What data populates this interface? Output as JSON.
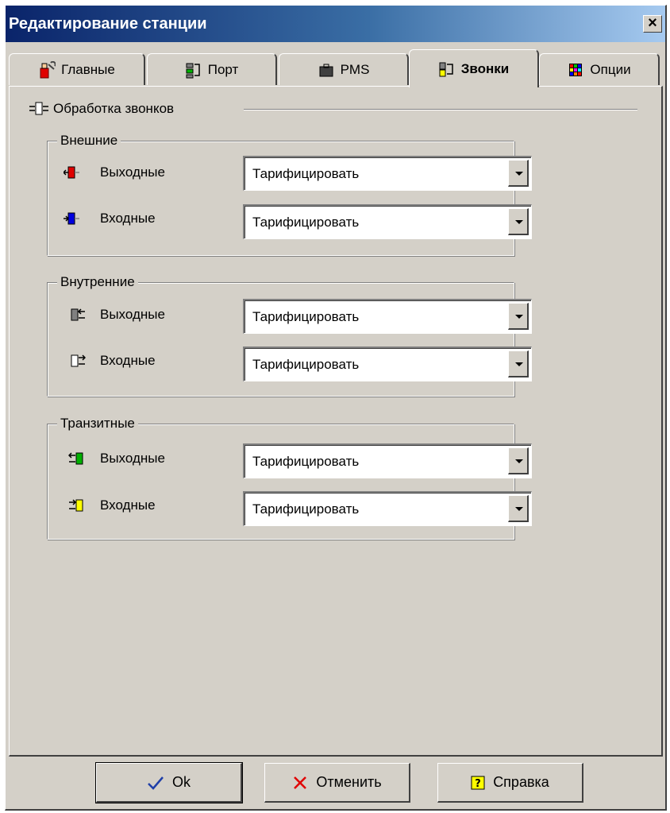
{
  "window": {
    "title": "Редактирование станции",
    "close_label": "×"
  },
  "tabs": [
    {
      "label": "Главные",
      "icon": "tools-icon"
    },
    {
      "label": "Порт",
      "icon": "port-icon"
    },
    {
      "label": "PMS",
      "icon": "pms-icon"
    },
    {
      "label": "Звонки",
      "icon": "calls-icon",
      "active": true
    },
    {
      "label": "Опции",
      "icon": "options-icon"
    }
  ],
  "section": {
    "title": "Обработка звонков"
  },
  "groups": {
    "external": {
      "title": "Внешние",
      "outgoing": {
        "label": "Выходные",
        "value": "Тарифицировать"
      },
      "incoming": {
        "label": "Входные",
        "value": "Тарифицировать"
      }
    },
    "internal": {
      "title": "Внутренние",
      "outgoing": {
        "label": "Выходные",
        "value": "Тарифицировать"
      },
      "incoming": {
        "label": "Входные",
        "value": "Тарифицировать"
      }
    },
    "transit": {
      "title": "Транзитные",
      "outgoing": {
        "label": "Выходные",
        "value": "Тарифицировать"
      },
      "incoming": {
        "label": "Входные",
        "value": "Тарифицировать"
      }
    }
  },
  "buttons": {
    "ok": "Ok",
    "cancel": "Отменить",
    "help": "Справка"
  },
  "colors": {
    "title_start": "#0a246a",
    "title_end": "#a6caf0",
    "face": "#d4d0c8",
    "red": "#e00000",
    "blue": "#0000e0",
    "green": "#00b000",
    "yellow": "#ffff00"
  }
}
